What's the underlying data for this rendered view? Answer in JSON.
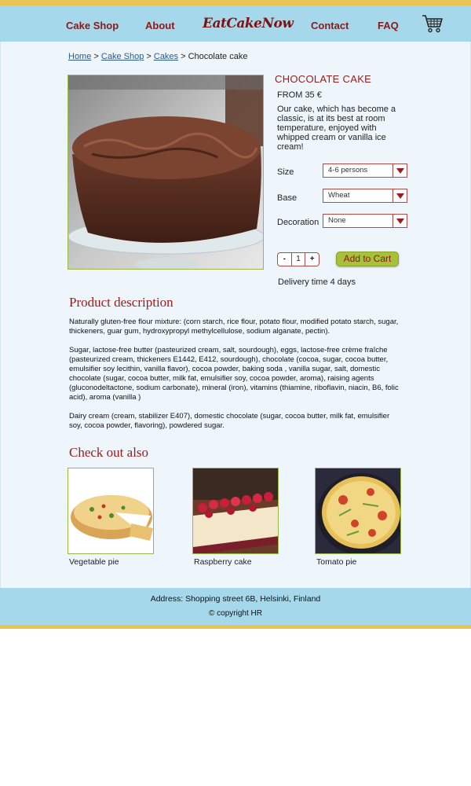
{
  "nav": {
    "cake_shop": "Cake Shop",
    "about": "About",
    "logo": "EatCakeNow",
    "contact": "Contact",
    "faq": "FAQ",
    "cart_icon": "shopping-cart-icon"
  },
  "breadcrumb": {
    "home": "Home",
    "sep1": " > ",
    "cake_shop": "Cake Shop",
    "sep2": " > ",
    "cakes": "Cakes",
    "sep3": " >  ",
    "current": "Chocolate cake"
  },
  "product": {
    "title": "CHOCOLATE CAKE",
    "price": "FROM 35 €",
    "blurb": "Our cake, which has become a classic, is at its best at room temperature, enjoyed with whipped cream or vanilla ice cream!",
    "options": {
      "size_label": "Size",
      "size_value": "4-6 persons",
      "base_label": "Base",
      "base_value": "Wheat",
      "decoration_label": "Decoration",
      "decoration_value": "None"
    },
    "qty": {
      "minus": "-",
      "value": "1",
      "plus": "+"
    },
    "add_to_cart": "Add to Cart",
    "delivery": "Delivery time 4 days"
  },
  "description": {
    "heading": "Product description",
    "paragraphs": [
      "Naturally gluten-free flour mixture: (corn starch, rice flour, potato flour, modified potato starch, sugar, thickeners, guar gum, hydroxypropyl methylcellulose, sodium alganate, pectin).",
      "Sugar, lactose-free butter (pasteurized cream, salt, sourdough), eggs, lactose-free crème fraîche (pasteurized cream, thickeners E1442, E412, sourdough), chocolate (cocoa, sugar, cocoa butter, emulsifier soy lecithin, vanilla flavor), cocoa powder, baking soda , vanilla sugar, salt, domestic chocolate (sugar, cocoa butter, milk fat, emulsifier soy, cocoa powder, aroma), raising agents (gluconodeltactone, sodium carbonate), mineral (iron), vitamins (thiamine, riboflavin, niacin, B6, folic acid), aroma (vanilla )",
      "Dairy cream (cream, stabilizer E407), domestic chocolate (sugar, cocoa butter, milk fat, emulsifier soy, cocoa powder, flavoring), powdered sugar."
    ]
  },
  "also": {
    "heading": "Check out also",
    "items": [
      {
        "label": "Vegetable pie"
      },
      {
        "label": "Raspberry cake"
      },
      {
        "label": "Tomato pie"
      }
    ]
  },
  "footer": {
    "address": "Address: Shopping street 6B, Helsinki, Finland",
    "copyright": "© copyright HR"
  },
  "colors": {
    "header_bg": "#a6d8ec",
    "accent_red": "#9a1a1a",
    "stripe_yellow": "#e7c453",
    "button_green": "#a7c23a",
    "page_bg": "#eef5fb"
  }
}
